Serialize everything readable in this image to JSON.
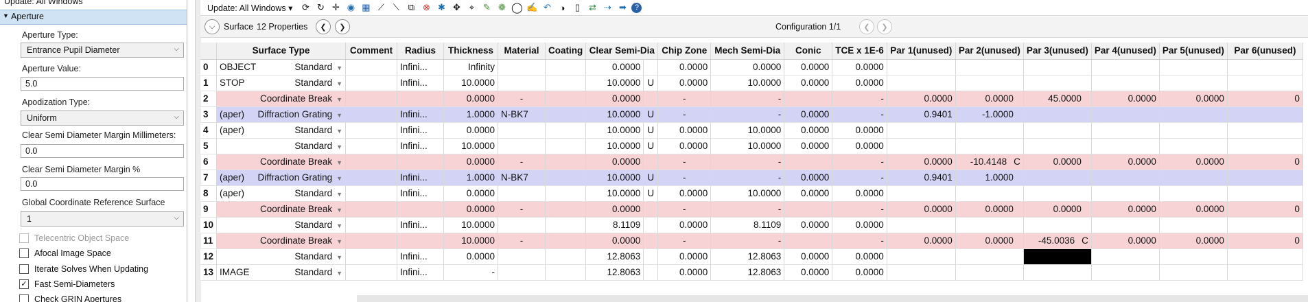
{
  "left_panel": {
    "update_label": "Update: All Windows",
    "section_title": "Aperture",
    "aperture_type_label": "Aperture Type:",
    "aperture_type_value": "Entrance Pupil Diameter",
    "aperture_value_label": "Aperture Value:",
    "aperture_value": "5.0",
    "apodization_label": "Apodization Type:",
    "apodization_value": "Uniform",
    "csd_margin_mm_label": "Clear Semi Diameter Margin Millimeters:",
    "csd_margin_mm_value": "0.0",
    "csd_margin_pct_label": "Clear Semi Diameter Margin %",
    "csd_margin_pct_value": "0.0",
    "gcrs_label": "Global Coordinate Reference Surface",
    "gcrs_value": "1",
    "checkboxes": [
      {
        "label": "Telecentric Object Space",
        "checked": false,
        "enabled": false
      },
      {
        "label": "Afocal Image Space",
        "checked": false,
        "enabled": true
      },
      {
        "label": "Iterate Solves When Updating",
        "checked": false,
        "enabled": true
      },
      {
        "label": "Fast Semi-Diameters",
        "checked": true,
        "enabled": true
      },
      {
        "label": "Check GRIN Apertures",
        "checked": false,
        "enabled": true
      }
    ]
  },
  "toolbar": {
    "update_label": "Update: All Windows ▾",
    "icons": [
      "refresh-icon",
      "refresh-all-icon",
      "move-icon",
      "globe-icon",
      "image-icon",
      "tool-a-icon",
      "tool-b-icon",
      "tool-c-icon",
      "tool-d-icon",
      "tool-e-icon",
      "tool-f-icon",
      "tool-g-icon",
      "tool-h-icon",
      "tool-i-icon",
      "circle-icon",
      "pen-icon",
      "undo-icon",
      "toggle-icon",
      "page-icon",
      "swap-icon",
      "dots-arrow-icon",
      "right-arrow-icon",
      "help-icon"
    ]
  },
  "surface_bar": {
    "surface_label": "Surface",
    "properties_label": "12 Properties",
    "configuration_label": "Configuration 1/1"
  },
  "grid": {
    "columns": [
      "Surface Type",
      "Comment",
      "Radius",
      "Thickness",
      "Material",
      "Coating",
      "Clear Semi-Dia",
      "Chip Zone",
      "Mech Semi-Dia",
      "Conic",
      "TCE x 1E-6",
      "Par 1(unused)",
      "Par 2(unused)",
      "Par 3(unused)",
      "Par 4(unused)",
      "Par 5(unused)",
      "Par 6(unused)"
    ],
    "rows": [
      {
        "idx": "0",
        "comment": "OBJECT",
        "type": "Standard",
        "radius": "Infini...",
        "thickness": "Infinity",
        "tsol": "",
        "material": "",
        "coating": "",
        "csd": "0.0000",
        "csdsol": "",
        "chip": "0.0000",
        "mech": "0.0000",
        "conic": "0.0000",
        "tce": "0.0000",
        "p1": "",
        "p1s": "",
        "p2": "",
        "p2s": "",
        "p3": "",
        "p3s": "",
        "p4": "",
        "p5": "",
        "p6": "",
        "kind": "std"
      },
      {
        "idx": "1",
        "comment": "STOP",
        "type": "Standard",
        "radius": "Infini...",
        "thickness": "10.0000",
        "tsol": "",
        "material": "",
        "coating": "",
        "csd": "10.0000",
        "csdsol": "U",
        "chip": "0.0000",
        "mech": "10.0000",
        "conic": "0.0000",
        "tce": "0.0000",
        "p1": "",
        "p1s": "",
        "p2": "",
        "p2s": "",
        "p3": "",
        "p3s": "",
        "p4": "",
        "p5": "",
        "p6": "",
        "kind": "std"
      },
      {
        "idx": "2",
        "comment": "",
        "type": "Coordinate Break",
        "radius": "",
        "thickness": "0.0000",
        "tsol": "",
        "material": "-",
        "coating": "",
        "csd": "0.0000",
        "csdsol": "",
        "chip": "-",
        "mech": "-",
        "conic": "",
        "tce": "-",
        "p1": "0.0000",
        "p1s": "",
        "p2": "0.0000",
        "p2s": "",
        "p3": "45.0000",
        "p3s": "",
        "p4": "0.0000",
        "p5": "0.0000",
        "p6": "0",
        "kind": "cb"
      },
      {
        "idx": "3",
        "comment": "(aper)",
        "type": "Diffraction Grating",
        "radius": "Infini...",
        "thickness": "1.0000",
        "tsol": "",
        "material": "N-BK7",
        "coating": "",
        "csd": "10.0000",
        "csdsol": "U",
        "chip": "-",
        "mech": "-",
        "conic": "0.0000",
        "tce": "-",
        "p1": "0.9401",
        "p1s": "",
        "p2": "-1.0000",
        "p2s": "",
        "p3": "",
        "p3s": "",
        "p4": "",
        "p5": "",
        "p6": "",
        "kind": "dg"
      },
      {
        "idx": "4",
        "comment": "(aper)",
        "type": "Standard",
        "radius": "Infini...",
        "thickness": "0.0000",
        "tsol": "",
        "material": "",
        "coating": "",
        "csd": "10.0000",
        "csdsol": "U",
        "chip": "0.0000",
        "mech": "10.0000",
        "conic": "0.0000",
        "tce": "0.0000",
        "p1": "",
        "p1s": "",
        "p2": "",
        "p2s": "",
        "p3": "",
        "p3s": "",
        "p4": "",
        "p5": "",
        "p6": "",
        "kind": "std"
      },
      {
        "idx": "5",
        "comment": "",
        "type": "Standard",
        "radius": "Infini...",
        "thickness": "10.0000",
        "tsol": "",
        "material": "",
        "coating": "",
        "csd": "10.0000",
        "csdsol": "U",
        "chip": "0.0000",
        "mech": "10.0000",
        "conic": "0.0000",
        "tce": "0.0000",
        "p1": "",
        "p1s": "",
        "p2": "",
        "p2s": "",
        "p3": "",
        "p3s": "",
        "p4": "",
        "p5": "",
        "p6": "",
        "kind": "std"
      },
      {
        "idx": "6",
        "comment": "",
        "type": "Coordinate Break",
        "radius": "",
        "thickness": "0.0000",
        "tsol": "",
        "material": "-",
        "coating": "",
        "csd": "0.0000",
        "csdsol": "",
        "chip": "-",
        "mech": "-",
        "conic": "",
        "tce": "-",
        "p1": "0.0000",
        "p1s": "",
        "p2": "-10.4148",
        "p2s": "C",
        "p3": "0.0000",
        "p3s": "",
        "p4": "0.0000",
        "p5": "0.0000",
        "p6": "0",
        "kind": "cb"
      },
      {
        "idx": "7",
        "comment": "(aper)",
        "type": "Diffraction Grating",
        "radius": "Infini...",
        "thickness": "1.0000",
        "tsol": "",
        "material": "N-BK7",
        "coating": "",
        "csd": "10.0000",
        "csdsol": "U",
        "chip": "-",
        "mech": "-",
        "conic": "0.0000",
        "tce": "-",
        "p1": "0.9401",
        "p1s": "",
        "p2": "1.0000",
        "p2s": "",
        "p3": "",
        "p3s": "",
        "p4": "",
        "p5": "",
        "p6": "",
        "kind": "dg"
      },
      {
        "idx": "8",
        "comment": "(aper)",
        "type": "Standard",
        "radius": "Infini...",
        "thickness": "0.0000",
        "tsol": "",
        "material": "",
        "coating": "",
        "csd": "10.0000",
        "csdsol": "U",
        "chip": "0.0000",
        "mech": "10.0000",
        "conic": "0.0000",
        "tce": "0.0000",
        "p1": "",
        "p1s": "",
        "p2": "",
        "p2s": "",
        "p3": "",
        "p3s": "",
        "p4": "",
        "p5": "",
        "p6": "",
        "kind": "std"
      },
      {
        "idx": "9",
        "comment": "",
        "type": "Coordinate Break",
        "radius": "",
        "thickness": "0.0000",
        "tsol": "",
        "material": "-",
        "coating": "",
        "csd": "0.0000",
        "csdsol": "",
        "chip": "-",
        "mech": "-",
        "conic": "",
        "tce": "-",
        "p1": "0.0000",
        "p1s": "",
        "p2": "0.0000",
        "p2s": "",
        "p3": "0.0000",
        "p3s": "",
        "p4": "0.0000",
        "p5": "0.0000",
        "p6": "0",
        "kind": "cb"
      },
      {
        "idx": "10",
        "comment": "",
        "type": "Standard",
        "radius": "Infini...",
        "thickness": "10.0000",
        "tsol": "",
        "material": "",
        "coating": "",
        "csd": "8.1109",
        "csdsol": "",
        "chip": "0.0000",
        "mech": "8.1109",
        "conic": "0.0000",
        "tce": "0.0000",
        "p1": "",
        "p1s": "",
        "p2": "",
        "p2s": "",
        "p3": "",
        "p3s": "",
        "p4": "",
        "p5": "",
        "p6": "",
        "kind": "std"
      },
      {
        "idx": "11",
        "comment": "",
        "type": "Coordinate Break",
        "radius": "",
        "thickness": "10.0000",
        "tsol": "",
        "material": "-",
        "coating": "",
        "csd": "0.0000",
        "csdsol": "",
        "chip": "-",
        "mech": "-",
        "conic": "",
        "tce": "-",
        "p1": "0.0000",
        "p1s": "",
        "p2": "0.0000",
        "p2s": "",
        "p3": "-45.0036",
        "p3s": "C",
        "p4": "0.0000",
        "p5": "0.0000",
        "p6": "0",
        "kind": "cb"
      },
      {
        "idx": "12",
        "comment": "",
        "type": "Standard",
        "radius": "Infini...",
        "thickness": "0.0000",
        "tsol": "",
        "material": "",
        "coating": "",
        "csd": "12.8063",
        "csdsol": "",
        "chip": "0.0000",
        "mech": "12.8063",
        "conic": "0.0000",
        "tce": "0.0000",
        "p1": "",
        "p1s": "",
        "p2": "",
        "p2s": "",
        "p3": "",
        "p3s": "",
        "p4": "",
        "p5": "",
        "p6": "",
        "kind": "std",
        "black_p3": true
      },
      {
        "idx": "13",
        "comment": "IMAGE",
        "type": "Standard",
        "radius": "Infini...",
        "thickness": "-",
        "tsol": "",
        "material": "",
        "coating": "",
        "csd": "12.8063",
        "csdsol": "",
        "chip": "0.0000",
        "mech": "12.8063",
        "conic": "0.0000",
        "tce": "0.0000",
        "p1": "",
        "p1s": "",
        "p2": "",
        "p2s": "",
        "p3": "",
        "p3s": "",
        "p4": "",
        "p5": "",
        "p6": "",
        "kind": "std"
      }
    ]
  }
}
